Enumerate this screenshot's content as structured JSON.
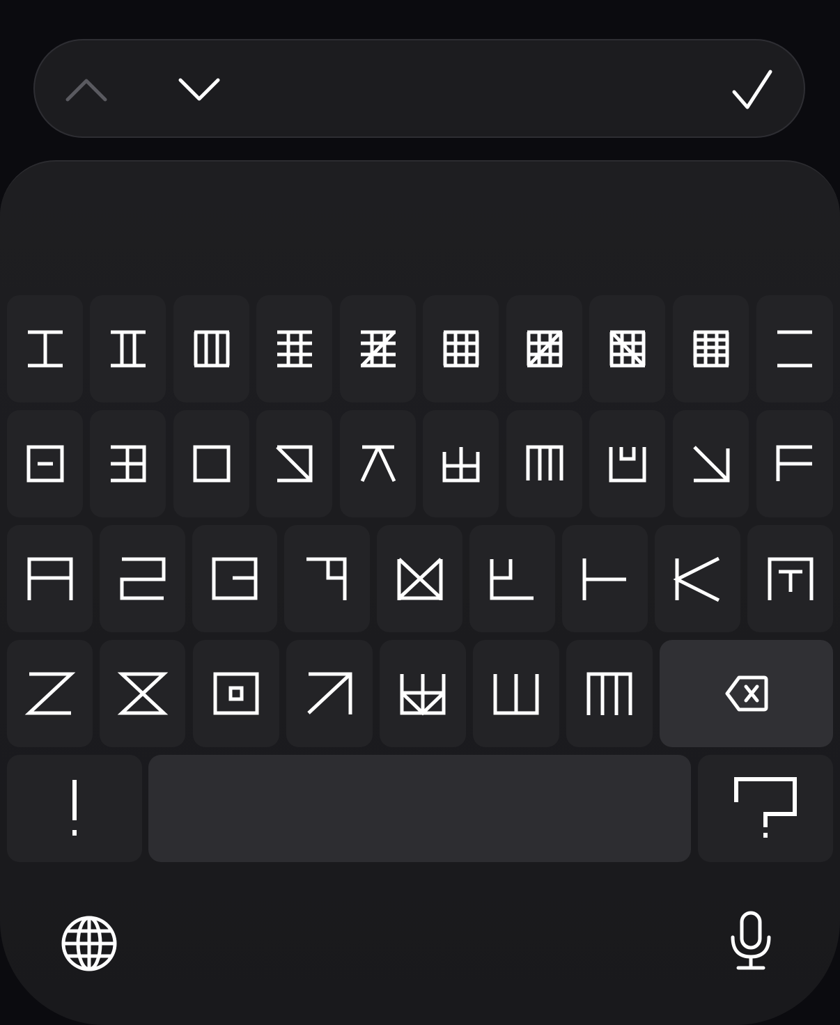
{
  "toolbar": {
    "prev_icon": "chevron-up-icon",
    "next_icon": "chevron-down-icon",
    "done_icon": "checkmark-icon"
  },
  "keyboard": {
    "rows": [
      [
        "glyph-i",
        "glyph-ii",
        "glyph-iii",
        "glyph-iv",
        "glyph-v",
        "glyph-vi",
        "glyph-vii",
        "glyph-viii",
        "glyph-ix",
        "glyph-two-bars"
      ],
      [
        "glyph-box-minus",
        "glyph-box-e",
        "glyph-box",
        "glyph-box-diagonal",
        "glyph-caret",
        "glyph-tooth",
        "glyph-m-arch",
        "glyph-cup",
        "glyph-arrow-down-right",
        "glyph-f"
      ],
      [
        "glyph-a",
        "glyph-two",
        "glyph-b",
        "glyph-seven",
        "glyph-box-x",
        "glyph-l-turn",
        "glyph-t-side",
        "glyph-k",
        "glyph-gate"
      ],
      [
        "glyph-z",
        "glyph-hourglass",
        "glyph-box-dot",
        "glyph-arrow-up-right",
        "glyph-basket",
        "glyph-u",
        "glyph-m-three"
      ]
    ],
    "delete_icon": "delete-backspace-icon",
    "exclamation_label": "!",
    "space_label": "",
    "question_icon": "question-glyph-icon",
    "globe_icon": "globe-icon",
    "mic_icon": "microphone-icon"
  },
  "colors": {
    "background": "#0b0b0f",
    "panel": "#1e1e21",
    "key": "#232326",
    "key_dark": "#303034",
    "glyph": "#ffffff",
    "dim": "#5a5a60"
  }
}
